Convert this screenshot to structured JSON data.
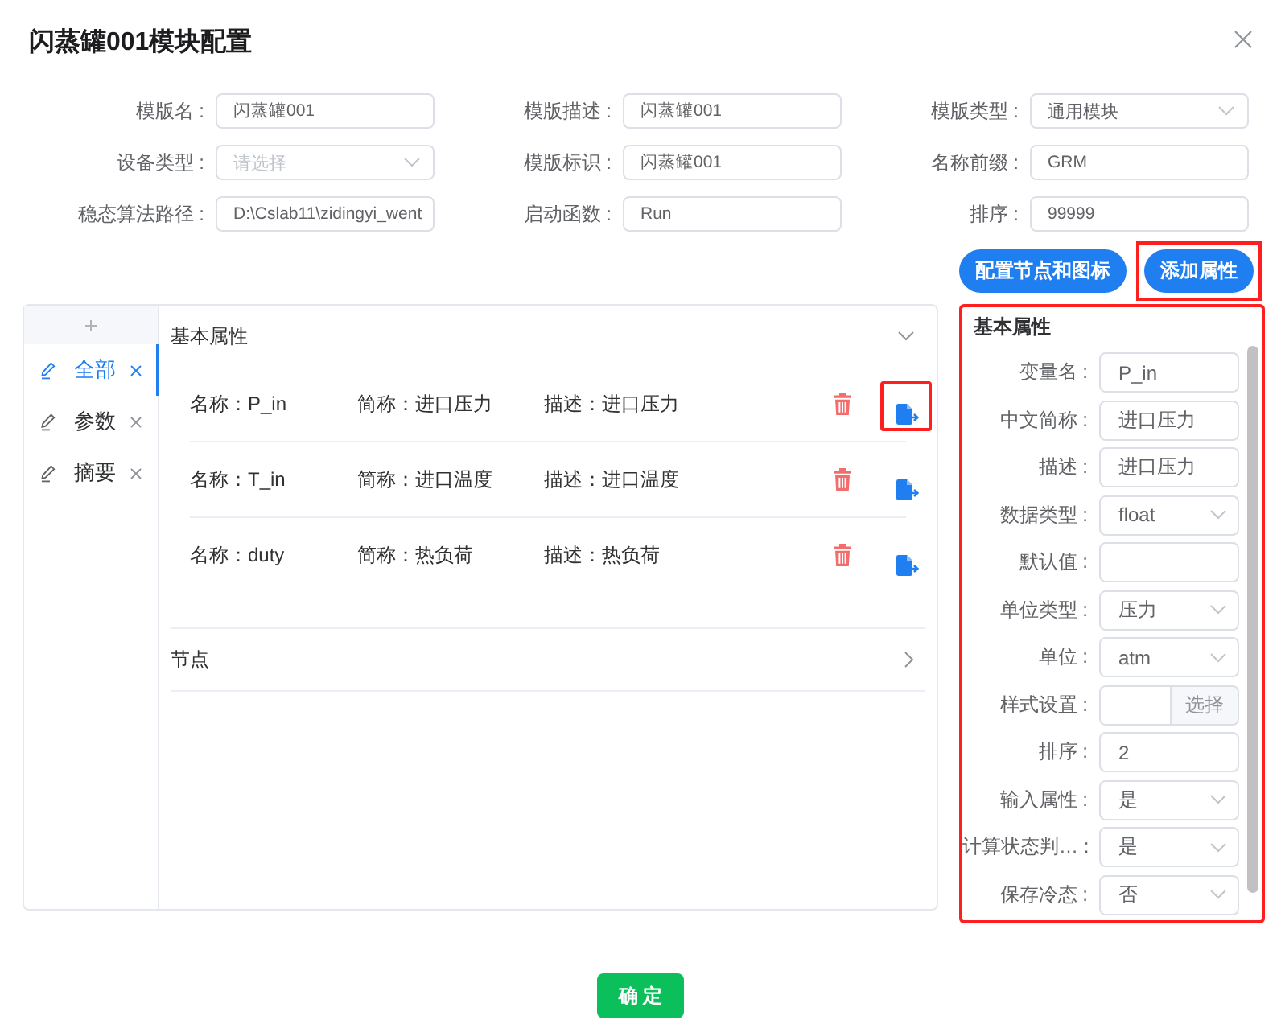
{
  "dialog": {
    "title": "闪蒸罐001模块配置"
  },
  "form": {
    "fields": [
      {
        "label": "模版名 :",
        "kind": "input",
        "value": "闪蒸罐001"
      },
      {
        "label": "模版描述 :",
        "kind": "input",
        "value": "闪蒸罐001"
      },
      {
        "label": "模版类型 :",
        "kind": "select",
        "value": "通用模块"
      },
      {
        "label": "设备类型 :",
        "kind": "select",
        "placeholder": "请选择"
      },
      {
        "label": "模版标识 :",
        "kind": "input",
        "value": "闪蒸罐001"
      },
      {
        "label": "名称前缀 :",
        "kind": "input",
        "value": "GRM"
      },
      {
        "label": "稳态算法路径 :",
        "kind": "input",
        "value": "D:\\Cslab11\\zidingyi_went"
      },
      {
        "label": "启动函数 :",
        "kind": "input",
        "value": "Run"
      },
      {
        "label": "排序 :",
        "kind": "input",
        "value": "99999"
      }
    ]
  },
  "actions": [
    {
      "label": "配置节点和图标",
      "highlighted": false
    },
    {
      "label": "添加属性",
      "highlighted": true
    }
  ],
  "sidebar": {
    "tabs": [
      {
        "label": "全部",
        "selected": true
      },
      {
        "label": "参数",
        "selected": false
      },
      {
        "label": "摘要",
        "selected": false
      }
    ]
  },
  "attribute_list": {
    "sections": [
      {
        "title": "基本属性",
        "expanded": true,
        "rows": [
          {
            "name": "名称：P_in",
            "short_name": "简称：进口压力",
            "description": "描述：进口压力",
            "highlighted": true
          },
          {
            "name": "名称：T_in",
            "short_name": "简称：进口温度",
            "description": "描述：进口温度",
            "highlighted": false
          },
          {
            "name": "名称：duty",
            "short_name": "简称：热负荷",
            "description": "描述：热负荷",
            "highlighted": false
          }
        ]
      },
      {
        "title": "节点",
        "expanded": false
      }
    ]
  },
  "property_panel": {
    "title": "基本属性",
    "highlighted": true,
    "fields": [
      {
        "label": "变量名 :",
        "kind": "input",
        "value": "P_in"
      },
      {
        "label": "中文简称 :",
        "kind": "input",
        "value": "进口压力"
      },
      {
        "label": "描述 :",
        "kind": "input",
        "value": "进口压力"
      },
      {
        "label": "数据类型 :",
        "kind": "select",
        "value": "float"
      },
      {
        "label": "默认值 :",
        "kind": "input"
      },
      {
        "label": "单位类型 :",
        "kind": "select",
        "value": "压力"
      },
      {
        "label": "单位 :",
        "kind": "select",
        "value": "atm"
      },
      {
        "label": "样式设置 :",
        "kind": "picker",
        "button": "选择"
      },
      {
        "label": "排序 :",
        "kind": "input",
        "value": "2"
      },
      {
        "label": "输入属性 :",
        "kind": "select",
        "value": "是"
      },
      {
        "label": "计算状态判… :",
        "kind": "select",
        "value": "是"
      },
      {
        "label": "保存冷态 :",
        "kind": "select",
        "value": "否"
      }
    ]
  },
  "footer": {
    "confirm": "确 定"
  }
}
